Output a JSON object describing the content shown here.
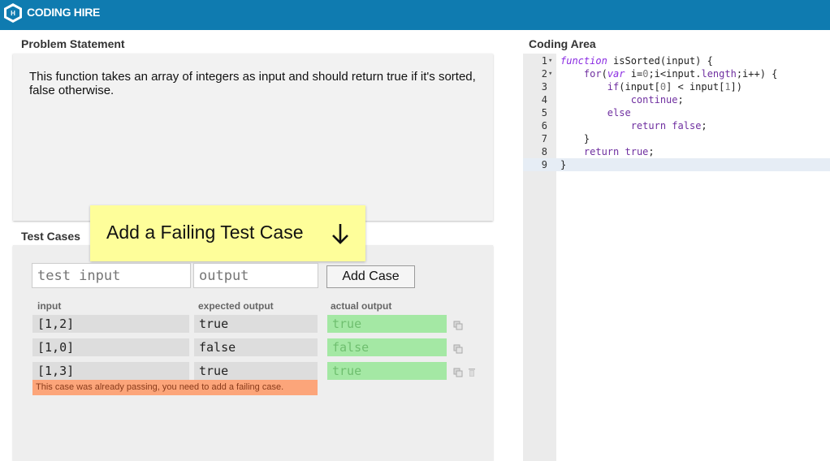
{
  "brand": {
    "name": "CODING HIRE",
    "mark": "H"
  },
  "problem": {
    "label": "Problem Statement",
    "text": "This function takes an array of integers as input and should return true if it's sorted, false otherwise."
  },
  "tests": {
    "label": "Test Cases",
    "tooltip": "Add a Failing Test Case",
    "input_placeholder": "test input",
    "output_placeholder": "output",
    "add_button": "Add Case",
    "columns": {
      "input": "input",
      "expected": "expected output",
      "actual": "actual output"
    },
    "rows": [
      {
        "input": "[1,2]",
        "expected": "true",
        "actual": "true"
      },
      {
        "input": "[1,0]",
        "expected": "false",
        "actual": "false"
      },
      {
        "input": "[1,3]",
        "expected": "true",
        "actual": "true"
      }
    ],
    "error": "This case was already passing, you need to add a failing case."
  },
  "coding": {
    "label": "Coding Area",
    "lines": [
      {
        "num": "1",
        "text": "function isSorted(input) {"
      },
      {
        "num": "2",
        "text": "    for(var i=0;i<input.length;i++) {"
      },
      {
        "num": "3",
        "text": "        if(input[0] < input[1])"
      },
      {
        "num": "4",
        "text": "            continue;"
      },
      {
        "num": "5",
        "text": "        else"
      },
      {
        "num": "6",
        "text": "            return false;"
      },
      {
        "num": "7",
        "text": "    }"
      },
      {
        "num": "8",
        "text": "    return true;"
      },
      {
        "num": "9",
        "text": "}"
      }
    ]
  }
}
